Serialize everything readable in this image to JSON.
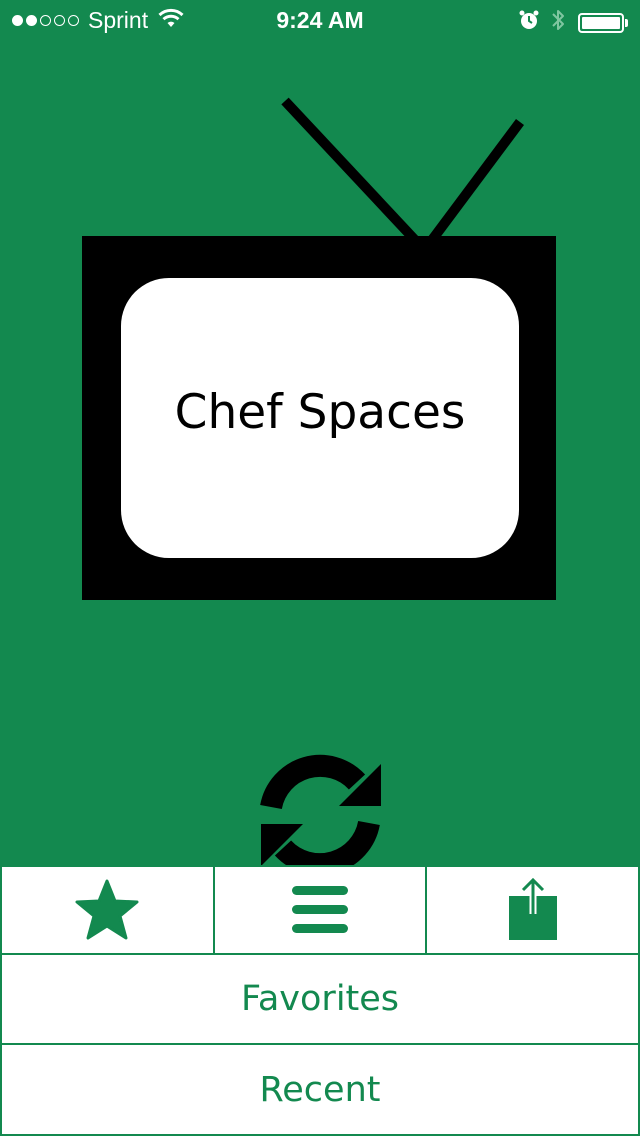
{
  "status_bar": {
    "signal_filled": 2,
    "signal_total": 5,
    "carrier": "Sprint",
    "time": "9:24 AM",
    "battery_level": 1.0
  },
  "logo": {
    "title": "Chef Spaces"
  },
  "toolbar": {
    "buttons": [
      {
        "icon": "star-icon"
      },
      {
        "icon": "menu-icon"
      },
      {
        "icon": "share-icon"
      }
    ]
  },
  "menu": {
    "favorites_label": "Favorites",
    "recent_label": "Recent"
  },
  "colors": {
    "background": "#13894f",
    "accent": "#13894f",
    "tv_frame": "#000000",
    "screen": "#ffffff"
  }
}
